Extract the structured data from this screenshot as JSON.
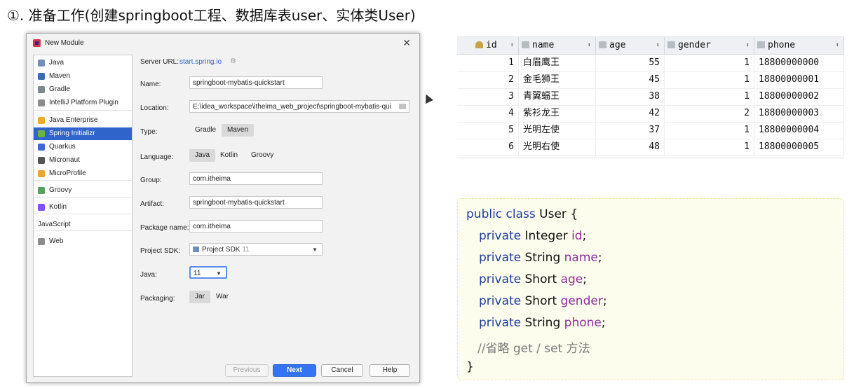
{
  "slide": {
    "title": "①. 准备工作(创建springboot工程、数据库表user、实体类User)"
  },
  "dialog": {
    "title": "New Module",
    "close": "✕",
    "generators": [
      {
        "label": "Java",
        "icon": "folder-icon",
        "color": "#6f8fbd"
      },
      {
        "label": "Maven",
        "icon": "maven-icon",
        "color": "#3c6db0"
      },
      {
        "label": "Gradle",
        "icon": "gradle-icon",
        "color": "#7a8a8c"
      },
      {
        "label": "IntelliJ Platform Plugin",
        "icon": "plugin-icon",
        "color": "#8c8c8c"
      },
      {
        "label": "Java Enterprise",
        "icon": "java-enterprise-icon",
        "color": "#f0a732"
      },
      {
        "label": "Spring Initializr",
        "icon": "spring-icon",
        "color": "#6cb33f"
      },
      {
        "label": "Quarkus",
        "icon": "quarkus-icon",
        "color": "#4166d5"
      },
      {
        "label": "Micronaut",
        "icon": "micronaut-icon",
        "color": "#555555"
      },
      {
        "label": "MicroProfile",
        "icon": "microprofile-icon",
        "color": "#e8a33a"
      },
      {
        "label": "Groovy",
        "icon": "groovy-icon",
        "color": "#53a35a"
      },
      {
        "label": "Kotlin",
        "icon": "kotlin-icon",
        "color": "#7f52ff"
      },
      {
        "label": "JavaScript",
        "icon": "",
        "color": ""
      },
      {
        "label": "Web",
        "icon": "globe-icon",
        "color": "#8c8c8c"
      }
    ],
    "selected_generator": "Spring Initializr",
    "server_url_label": "Server URL:",
    "server_url": "start.spring.io",
    "name_label": "Name:",
    "name_value": "springboot-mybatis-quickstart",
    "location_label": "Location:",
    "location_value": "E:\\idea_workspace\\itheima_web_project\\springboot-mybatis-qui",
    "type_label": "Type:",
    "type_options": [
      "Gradle",
      "Maven"
    ],
    "type_selected": "Maven",
    "language_label": "Language:",
    "language_options": [
      "Java",
      "Kotlin",
      "Groovy"
    ],
    "language_selected": "Java",
    "group_label": "Group:",
    "group_value": "com.itheima",
    "artifact_label": "Artifact:",
    "artifact_value": "springboot-mybatis-quickstart",
    "package_label": "Package name:",
    "package_value": "com.itheima",
    "sdk_label": "Project SDK:",
    "sdk_value": "Project SDK",
    "sdk_version": "11",
    "java_label": "Java:",
    "java_value": "11",
    "packaging_label": "Packaging:",
    "packaging_options": [
      "Jar",
      "War"
    ],
    "packaging_selected": "Jar",
    "buttons": {
      "previous": "Previous",
      "next": "Next",
      "cancel": "Cancel",
      "help": "Help"
    }
  },
  "table": {
    "columns": [
      "id",
      "name",
      "age",
      "gender",
      "phone"
    ],
    "rows": [
      [
        "1",
        "白眉鹰王",
        "55",
        "1",
        "18800000000"
      ],
      [
        "2",
        "金毛狮王",
        "45",
        "1",
        "18800000001"
      ],
      [
        "3",
        "青翼蝠王",
        "38",
        "1",
        "18800000002"
      ],
      [
        "4",
        "紫衫龙王",
        "42",
        "2",
        "18800000003"
      ],
      [
        "5",
        "光明左使",
        "37",
        "1",
        "18800000004"
      ],
      [
        "6",
        "光明右使",
        "48",
        "1",
        "18800000005"
      ]
    ]
  },
  "code": {
    "line1_kw": "public class",
    "line1_rest": " User {",
    "kw_private": "private",
    "fields": [
      {
        "type": "Integer",
        "name": "id"
      },
      {
        "type": "String",
        "name": "name"
      },
      {
        "type": "Short",
        "name": "age"
      },
      {
        "type": "Short",
        "name": "gender"
      },
      {
        "type": "String",
        "name": "phone"
      }
    ],
    "comment": "//省略 get / set 方法",
    "close": "}"
  }
}
